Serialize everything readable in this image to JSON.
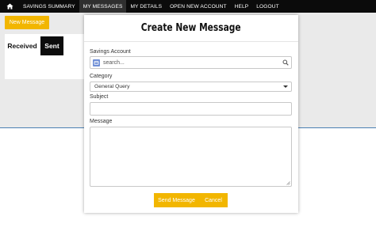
{
  "nav": {
    "home_icon": "home-icon",
    "items": [
      {
        "label": "SAVINGS SUMMARY",
        "active": false
      },
      {
        "label": "MY MESSAGES",
        "active": true
      },
      {
        "label": "MY DETAILS",
        "active": false
      },
      {
        "label": "OPEN NEW ACCOUNT",
        "active": false
      },
      {
        "label": "HELP",
        "active": false
      },
      {
        "label": "LOGOUT",
        "active": false
      }
    ]
  },
  "page": {
    "new_message_label": "New Message",
    "tabs": {
      "received": "Received",
      "sent": "Sent"
    }
  },
  "modal": {
    "title": "Create New Message",
    "savings_account": {
      "label": "Savings Account",
      "placeholder": "search..."
    },
    "category": {
      "label": "Category",
      "value": "General Query"
    },
    "subject": {
      "label": "Subject",
      "value": ""
    },
    "message": {
      "label": "Message",
      "value": ""
    },
    "send_label": "Send Message",
    "cancel_label": "Cancel"
  },
  "colors": {
    "accent": "#f2b600",
    "nav_bg": "#0b0b0b",
    "nav_active": "#2f2f2f",
    "page_bg": "#eaeaea"
  }
}
